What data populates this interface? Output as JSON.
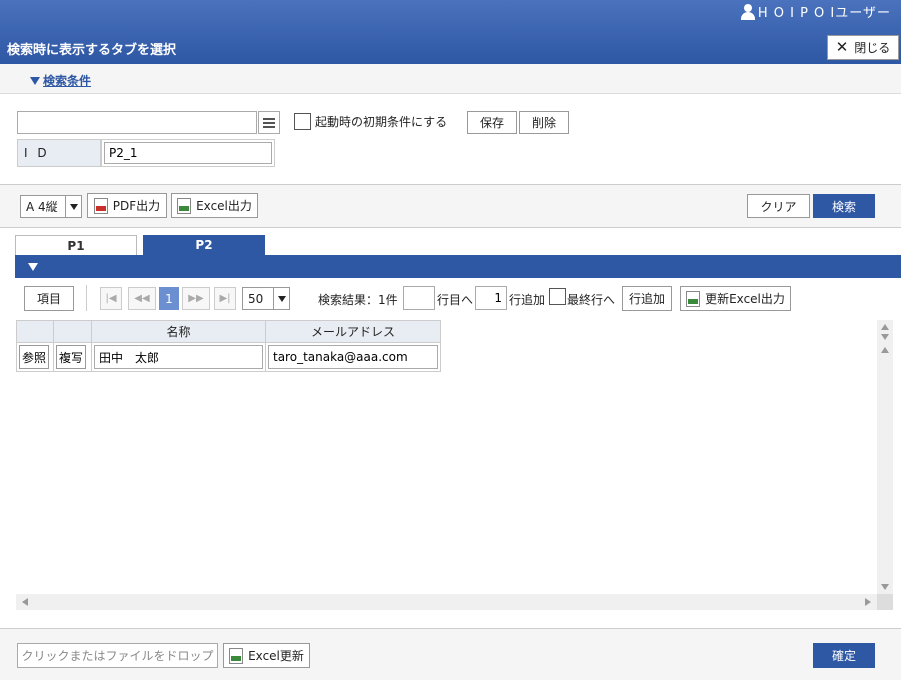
{
  "header": {
    "user_name": "H O I P O Iユーザー",
    "title": "検索時に表示するタブを選択",
    "close_label": "閉じる"
  },
  "conditions": {
    "toggle_label": "検索条件",
    "preset_value": "",
    "default_checkbox_label": "起動時の初期条件にする",
    "default_checked": false,
    "save_label": "保存",
    "delete_label": "削除",
    "id_label": "I D",
    "id_value": "P2_1"
  },
  "toolbar": {
    "paper_size": "A 4縦",
    "pdf_label": "PDF出力",
    "excel_label": "Excel出力",
    "clear_label": "クリア",
    "search_label": "検索"
  },
  "tabs": [
    {
      "label": "P1",
      "active": false
    },
    {
      "label": "P2",
      "active": true
    }
  ],
  "pager": {
    "items_label": "項目",
    "first": "|◀",
    "prev": "◀◀",
    "current_page": "1",
    "next": "▶▶",
    "last": "▶|",
    "rows_per_page": "50",
    "result_text": "検索結果：1件",
    "goto_value": "",
    "goto_label": "行目へ",
    "add_rows_value": "1",
    "add_rows_label": "行追加",
    "last_row_label": "最終行へ",
    "add_row_button": "行追加",
    "update_excel_label": "更新Excel出力"
  },
  "grid": {
    "headers": [
      "",
      "",
      "名称",
      "メールアドレス"
    ],
    "rows": [
      {
        "ref_label": "参照",
        "copy_label": "複写",
        "name": "田中　太郎",
        "email": "taro_tanaka@aaa.com"
      }
    ]
  },
  "footer": {
    "drop_label": "クリックまたはファイルをドロップ",
    "excel_update_label": "Excel更新",
    "confirm_label": "確定"
  },
  "colors": {
    "primary": "#2e57a4",
    "header_bg": "#3a63b0",
    "label_bg": "#e8edf3",
    "page_current": "#6b8fd1"
  }
}
